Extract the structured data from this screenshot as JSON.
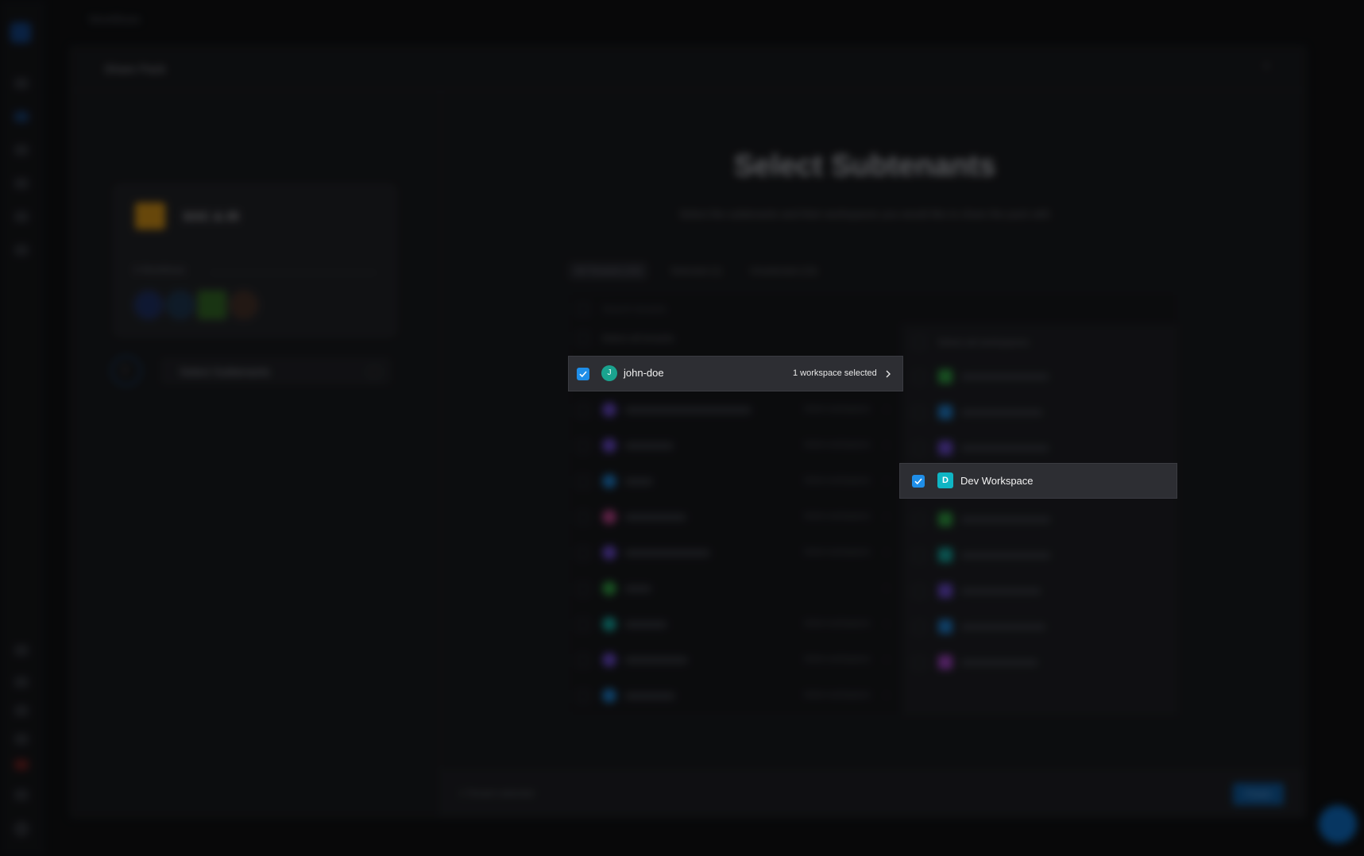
{
  "app": {
    "title": "Workflows"
  },
  "modal": {
    "title": "Share Pack",
    "close_symbol": "×"
  },
  "pack": {
    "name": "SOC & IR",
    "workflows_label": "4 Workflows"
  },
  "step": {
    "number": "1",
    "label": "Select Subtenants"
  },
  "main": {
    "title": "Select Subtenants",
    "subtitle": "Select the subtenants and their workspaces you would like to share the pack with"
  },
  "tabs": [
    {
      "label": "All Tenants (10)"
    },
    {
      "label": "Selected (1)"
    },
    {
      "label": "Unselected (13)"
    }
  ],
  "search": {
    "placeholder": "Search tenants"
  },
  "tenants": {
    "select_all_label": "Select all tenants",
    "selected_row": {
      "avatar_letter": "J",
      "name": "john-doe",
      "count_label": "1 workspace selected"
    },
    "other_row_label": "Select workspaces"
  },
  "workspaces": {
    "select_all_label": "Select all workspaces",
    "selected_row": {
      "badge_letter": "D",
      "name": "Dev Workspace"
    }
  },
  "footer": {
    "status": "1 Tenant selected",
    "finish_label": "Finish"
  },
  "colors": {
    "accent": "#1f8ee8",
    "tenant_avatar": "#1aa38f",
    "workspace_badge": "#0fb5c4"
  }
}
